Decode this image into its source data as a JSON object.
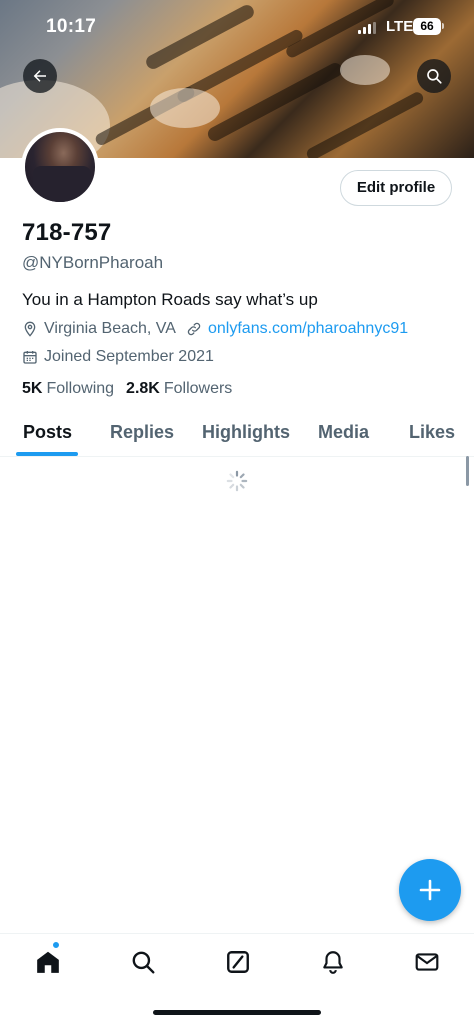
{
  "status_bar": {
    "time": "10:17",
    "network": "LTE",
    "battery": "66"
  },
  "profile": {
    "name": "718-757",
    "handle": "@NYBornPharoah",
    "bio": "You in a Hampton Roads say what’s up",
    "location": "Virginia Beach, VA",
    "link": "onlyfans.com/pharoahnyc91",
    "joined": "Joined September 2021",
    "following_count": "5K",
    "following_label": "Following",
    "followers_count": "2.8K",
    "followers_label": "Followers"
  },
  "edit_profile_label": "Edit profile",
  "tabs": [
    {
      "label": "Posts",
      "active": true
    },
    {
      "label": "Replies",
      "active": false
    },
    {
      "label": "Highlights",
      "active": false
    },
    {
      "label": "Media",
      "active": false
    },
    {
      "label": "Likes",
      "active": false
    }
  ],
  "bottom_nav": [
    {
      "icon": "home-icon",
      "active": true,
      "has_notification_dot": true
    },
    {
      "icon": "search-icon",
      "active": false
    },
    {
      "icon": "grok-icon",
      "active": false
    },
    {
      "icon": "bell-icon",
      "active": false
    },
    {
      "icon": "mail-icon",
      "active": false
    }
  ],
  "colors": {
    "accent": "#1d9bf0",
    "text": "#0f1419",
    "secondary": "#536471"
  }
}
